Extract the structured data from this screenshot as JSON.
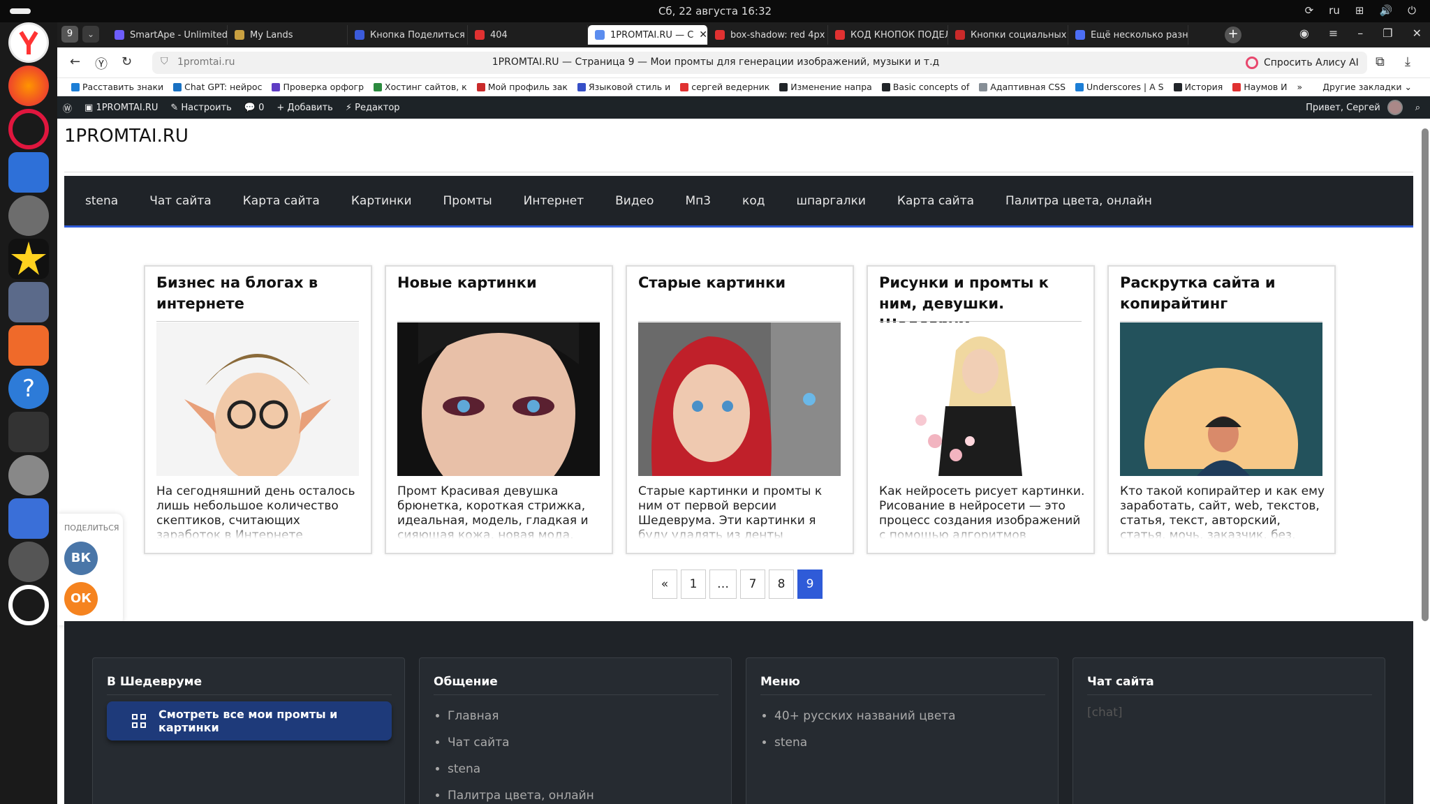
{
  "system": {
    "datetime": "Сб, 22 августа  16:32",
    "lang": "ru"
  },
  "browser": {
    "tab_count": "9",
    "tabs": [
      {
        "title": "SmartApe - Unlimited",
        "color": "#6d5dfc"
      },
      {
        "title": "My Lands",
        "color": "#c9a040"
      },
      {
        "title": "Кнопка Поделиться В",
        "color": "#3b5bdb"
      },
      {
        "title": "404",
        "color": "#e03131"
      },
      {
        "title": "1PROMTAI.RU — С",
        "color": "#5b8def"
      },
      {
        "title": "box-shadow: red 4px",
        "color": "#e03131"
      },
      {
        "title": "КОД КНОПОК ПОДЕЛ",
        "color": "#e03131"
      },
      {
        "title": "Кнопки социальных с",
        "color": "#c92a2a"
      },
      {
        "title": "Ещё несколько разны",
        "color": "#4c6ef5"
      }
    ],
    "url_host": "1promtai.ru",
    "page_title": "1PROMTAI.RU — Страница 9 — Мои промты для генерации изображений, музыки и т.д",
    "alisa_label": "Спросить Алису AI",
    "bookmarks": [
      {
        "label": "Расставить знаки",
        "color": "#1c7ed6"
      },
      {
        "label": "Chat GPT: нейрос",
        "color": "#1971c2"
      },
      {
        "label": "Проверка орфогр",
        "color": "#5f3dc4"
      },
      {
        "label": "Хостинг сайтов, к",
        "color": "#2b8a3e"
      },
      {
        "label": "Мой профиль зак",
        "color": "#c92a2a"
      },
      {
        "label": "Языковой стиль и",
        "color": "#364fc7"
      },
      {
        "label": "сергей ведерник",
        "color": "#e03131"
      },
      {
        "label": "Изменение напра",
        "color": "#212529"
      },
      {
        "label": "Basic concepts of",
        "color": "#212529"
      },
      {
        "label": "Адаптивная CSS",
        "color": "#868e96"
      },
      {
        "label": "Underscores | A S",
        "color": "#1c7ed6"
      },
      {
        "label": "История",
        "color": "#212529"
      },
      {
        "label": "Наумов И",
        "color": "#e03131"
      }
    ],
    "bookmarks_other": "Другие закладки"
  },
  "wpadmin": {
    "site": "1PROMTAI.RU",
    "customize": "Настроить",
    "comments": "0",
    "add": "Добавить",
    "editor": "Редактор",
    "greeting": "Привет, Сергей"
  },
  "site": {
    "title": "1PROMTAI.RU",
    "nav": [
      "stena",
      "Чат сайта",
      "Карта сайта",
      "Картинки",
      "Промты",
      "Интернет",
      "Видео",
      "Мп3",
      "код",
      "шпаргалки",
      "Карта сайта",
      "Палитра цвета, онлайн"
    ],
    "cards": [
      {
        "title": "Бизнес на блогах в интернете",
        "excerpt": "На сегодняшний день осталось лишь небольшое количество скептиков, считающих заработок в Интернете нереальным для"
      },
      {
        "title": "Новые картинки",
        "excerpt": "Промт Красивая девушка брюнетка, короткая стрижка, идеальная, модель, гладкая и сияющая кожа, новая мода,"
      },
      {
        "title": "Старые картинки",
        "excerpt": "Старые картинки и промты к ним от первой версии Шедеврума. Эти картинки я буду удалять из ленты приложения «Шедеврум»,"
      },
      {
        "title": "Рисунки и промты к ним, девушки. Шедеврум",
        "excerpt": "Как нейросеть рисует картинки. Рисование в нейросети — это процесс создания изображений с помощью алгоритмов машинного"
      },
      {
        "title": "Раскрутка сайта и копирайтинг",
        "excerpt": "Кто такой копирайтер и как ему заработать, сайт, web, текстов, статья, текст, авторский, статья, мочь, заказчик, без, правый,"
      }
    ],
    "pager": [
      "«",
      "1",
      "…",
      "7",
      "8",
      "9"
    ],
    "share": {
      "label": "ПОДЕЛИТЬСЯ",
      "vk": "ВК",
      "ok": "ОК"
    },
    "footer": {
      "col1": {
        "title": "В Шедевруме",
        "button": "Смотреть все мои промты и картинки"
      },
      "col2": {
        "title": "Общение",
        "items": [
          "Главная",
          "Чат сайта",
          "stena",
          "Палитра цвета, онлайн"
        ]
      },
      "col3": {
        "title": "Меню",
        "items": [
          "40+ русских названий цвета",
          "stena"
        ]
      },
      "col4": {
        "title": "Чат сайта",
        "text": "[chat]"
      }
    }
  }
}
